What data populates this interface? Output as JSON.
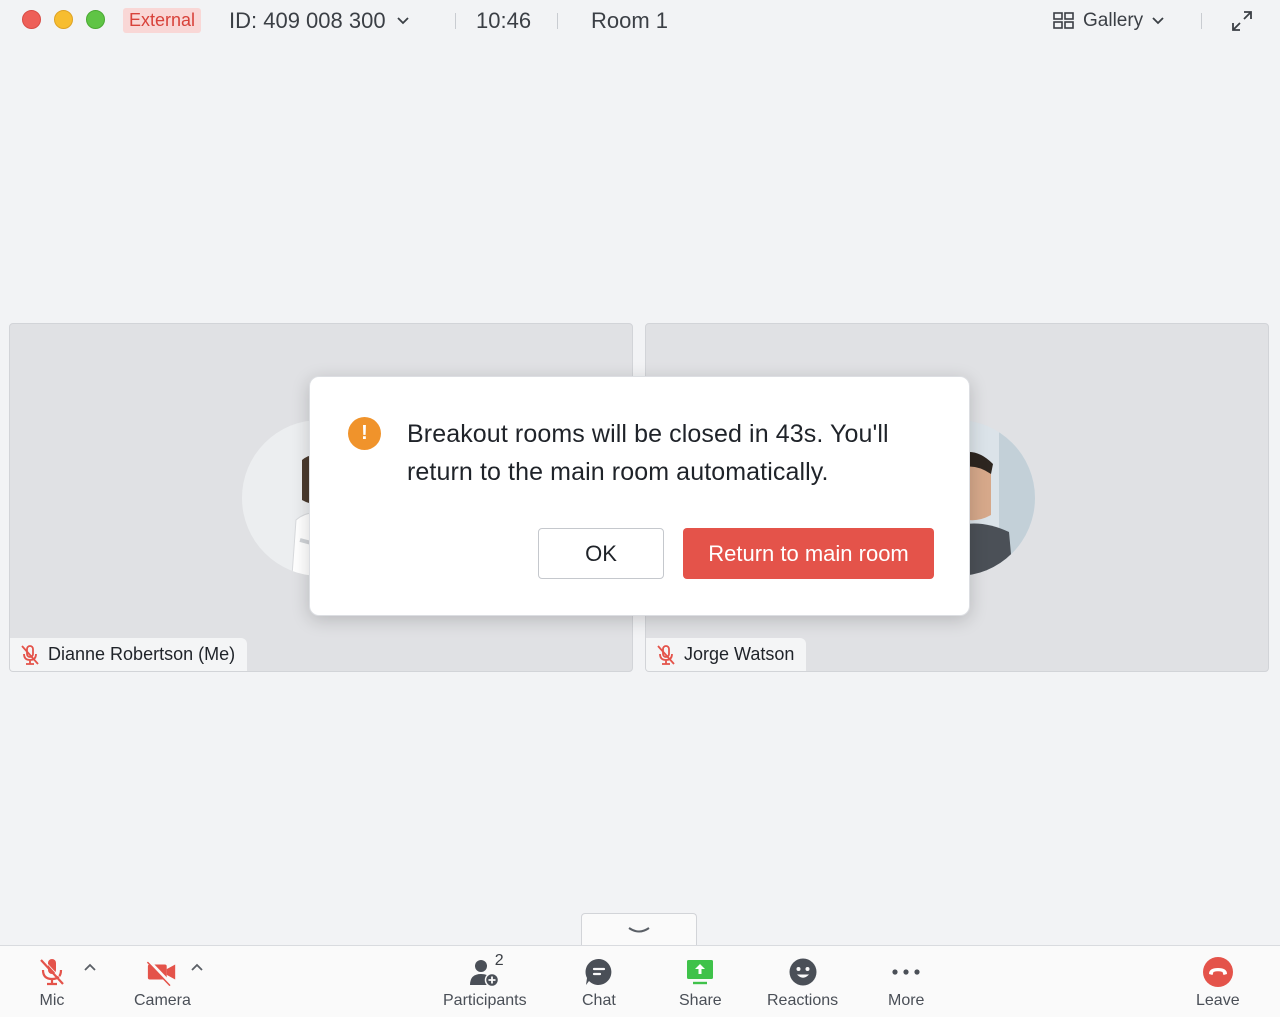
{
  "titlebar": {
    "badge": "External",
    "meeting_id": "ID: 409 008 300",
    "timer": "10:46",
    "room": "Room 1",
    "view_mode": "Gallery"
  },
  "tiles": [
    {
      "name": "Dianne Robertson (Me)",
      "muted": true
    },
    {
      "name": "Jorge Watson",
      "muted": true
    }
  ],
  "dialog": {
    "message": "Breakout rooms will be closed in 43s. You'll return to the main room automatically.",
    "ok_label": "OK",
    "return_label": "Return to main room"
  },
  "toolbar": {
    "mic": "Mic",
    "camera": "Camera",
    "participants": "Participants",
    "participants_count": "2",
    "chat": "Chat",
    "share": "Share",
    "reactions": "Reactions",
    "more": "More",
    "leave": "Leave"
  },
  "colors": {
    "accent_red": "#e4534a",
    "warning_orange": "#f0932b",
    "share_green": "#3fc24a",
    "external_badge_bg": "#f9d7d6"
  }
}
